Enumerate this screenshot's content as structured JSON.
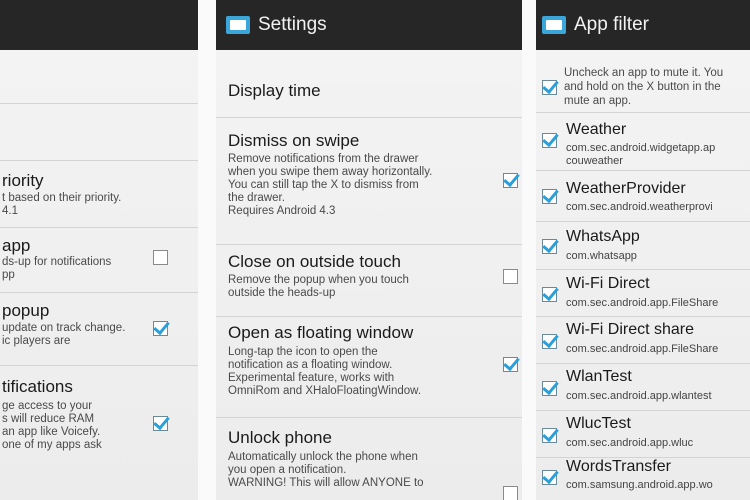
{
  "left_panel": {
    "items": [
      {
        "title": "riority",
        "summary": "t based on their priority.\n4.1"
      },
      {
        "title": "app",
        "summary": "ds-up for notifications\npp",
        "checked": false
      },
      {
        "title": "popup",
        "summary": "update on track change.\nic players are",
        "checked": true
      },
      {
        "title": "tifications",
        "summary": "ge access to your\ns will reduce RAM\nan app like Voicefy.\none of my apps ask",
        "checked": true
      }
    ]
  },
  "settings_panel": {
    "title": "Settings",
    "icon": "app-logo-icon",
    "items": [
      {
        "title": "Display time",
        "summary": ""
      },
      {
        "title": "Dismiss on swipe",
        "summary": "Remove notifications from the drawer\nwhen you swipe them away horizontally.\nYou can still tap the X to dismiss from\nthe drawer.\nRequires Android 4.3",
        "checked": true
      },
      {
        "title": "Close on outside touch",
        "summary": "Remove the popup when you touch\noutside the heads-up",
        "checked": false
      },
      {
        "title": "Open as floating window",
        "summary": "Long-tap the icon to open the\nnotification as a floating window.\nExperimental feature, works with\nOmniRom and XHaloFloatingWindow.",
        "checked": true
      },
      {
        "title": "Unlock phone",
        "summary": "Automatically unlock the phone when\nyou open a notification.\nWARNING! This will allow ANYONE to",
        "checked": false
      }
    ]
  },
  "app_filter_panel": {
    "title": "App filter",
    "icon": "app-logo-icon",
    "hint": "Uncheck an app to mute it. You\nand hold on the X button in the\nmute an app.",
    "apps": [
      {
        "name": "Weather",
        "package": "com.sec.android.widgetapp.ap\ncouweather",
        "checked": true
      },
      {
        "name": "WeatherProvider",
        "package": "com.sec.android.weatherprovi",
        "checked": true
      },
      {
        "name": "WhatsApp",
        "package": "com.whatsapp",
        "checked": true
      },
      {
        "name": "Wi-Fi Direct",
        "package": "com.sec.android.app.FileShare",
        "checked": true
      },
      {
        "name": "Wi-Fi Direct share",
        "package": "com.sec.android.app.FileShare",
        "checked": true
      },
      {
        "name": "WlanTest",
        "package": "com.sec.android.app.wlantest",
        "checked": true
      },
      {
        "name": "WlucTest",
        "package": "com.sec.android.app.wluc",
        "checked": true
      },
      {
        "name": "WordsTransfer",
        "package": "com.samsung.android.app.wo",
        "checked": true
      }
    ]
  },
  "colors": {
    "action_bar": "#262626",
    "accent": "#2b9fd8",
    "background": "#f0f0f0"
  }
}
